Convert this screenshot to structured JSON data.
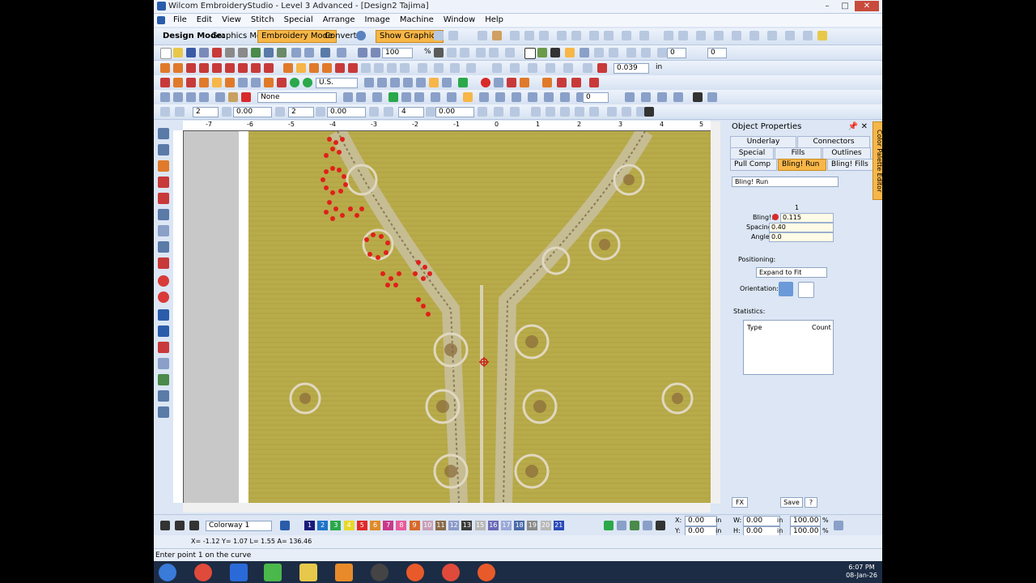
{
  "window": {
    "title": "Wilcom EmbroideryStudio - Level 3 Advanced - [Design2    Tajima]",
    "minimize": "–",
    "maximize": "□",
    "close": "✕"
  },
  "menu": [
    "File",
    "Edit",
    "View",
    "Stitch",
    "Special",
    "Arrange",
    "Image",
    "Machine",
    "Window",
    "Help"
  ],
  "toolbar": {
    "design_mode_label": "Design Mode:",
    "graphics_mode": "Graphics Mode",
    "embroidery_mode": "Embroidery Mode",
    "convert": "Convert",
    "show_graphics": "Show Graphics",
    "zoom_value": "100",
    "zoom_unit": "%",
    "thickness_value": "0.039",
    "thickness_unit": "in",
    "units_select": "U.S.",
    "none_select": "None",
    "field_a": "0",
    "field_b": "0",
    "row5_val1": "2",
    "row5_val2": "0.00",
    "row5_val3": "2",
    "row5_val4": "0.00",
    "row5_val5": "4",
    "row5_val6": "0.00",
    "row5_val7": "0"
  },
  "rulers": {
    "top": [
      "-7",
      "-6",
      "-5",
      "-4",
      "-3",
      "-2",
      "-1",
      "0",
      "1",
      "2",
      "3",
      "4",
      "5"
    ]
  },
  "panel": {
    "title": "Object Properties",
    "pin": "📌",
    "close": "✕",
    "tabs_row1": [
      "Underlay",
      "Connectors"
    ],
    "tabs_row2": [
      "Special",
      "Fills",
      "Outlines"
    ],
    "tabs_row3": [
      "Pull Comp",
      "Bling! Run",
      "Bling! Fills"
    ],
    "active_tab": "Bling! Run",
    "type_select": "Bling! Run",
    "column_header": "1",
    "bling_label": "Bling!:",
    "bling_value": "0.115",
    "spacing_label": "Spacing:",
    "spacing_value": "0.40",
    "angle_label": "Angle:",
    "angle_value": "0.0",
    "positioning_label": "Positioning:",
    "positioning_value": "Expand to Fit",
    "orientation_label": "Orientation:",
    "statistics_label": "Statistics:",
    "stat_type": "Type",
    "stat_count": "Count",
    "fx": "FX",
    "save": "Save",
    "help": "?",
    "side_tab": "Color Palette Editor"
  },
  "bottom": {
    "colorway": "Colorway 1",
    "colors": [
      {
        "n": "1",
        "c": "#1a1a7a"
      },
      {
        "n": "2",
        "c": "#1e73c8"
      },
      {
        "n": "3",
        "c": "#2aa84a"
      },
      {
        "n": "4",
        "c": "#e8d82a"
      },
      {
        "n": "5",
        "c": "#e02a2a"
      },
      {
        "n": "6",
        "c": "#e08a2a"
      },
      {
        "n": "7",
        "c": "#c83a8a"
      },
      {
        "n": "8",
        "c": "#e85a9a"
      },
      {
        "n": "9",
        "c": "#d86a2a"
      },
      {
        "n": "10",
        "c": "#c8a0b8"
      },
      {
        "n": "11",
        "c": "#8a6a4a"
      },
      {
        "n": "12",
        "c": "#8a9ac8"
      },
      {
        "n": "13",
        "c": "#3a3a3a"
      },
      {
        "n": "15",
        "c": "#b8b8b8"
      },
      {
        "n": "16",
        "c": "#6a6ab8"
      },
      {
        "n": "17",
        "c": "#9aa8d8"
      },
      {
        "n": "18",
        "c": "#4a6aa8"
      },
      {
        "n": "19",
        "c": "#8a8a8a"
      },
      {
        "n": "20",
        "c": "#b8b8b8"
      },
      {
        "n": "21",
        "c": "#2a4ab8"
      }
    ],
    "x_label": "X:",
    "x_value": "0.00",
    "x_unit": "in",
    "y_label": "Y:",
    "y_value": "0.00",
    "y_unit": "in",
    "w_label": "W:",
    "w_value": "0.00",
    "w_unit": "in",
    "h_label": "H:",
    "h_value": "0.00",
    "h_unit": "in",
    "w_pct": "100.00",
    "h_pct": "100.00",
    "pct": "%"
  },
  "coords": "X=  -1.12 Y=  1.07 L=   1.55 A= 136.46",
  "status": "Enter point 1 on the curve",
  "clock": {
    "time": "6:07 PM",
    "date": "08-Jan-26"
  }
}
